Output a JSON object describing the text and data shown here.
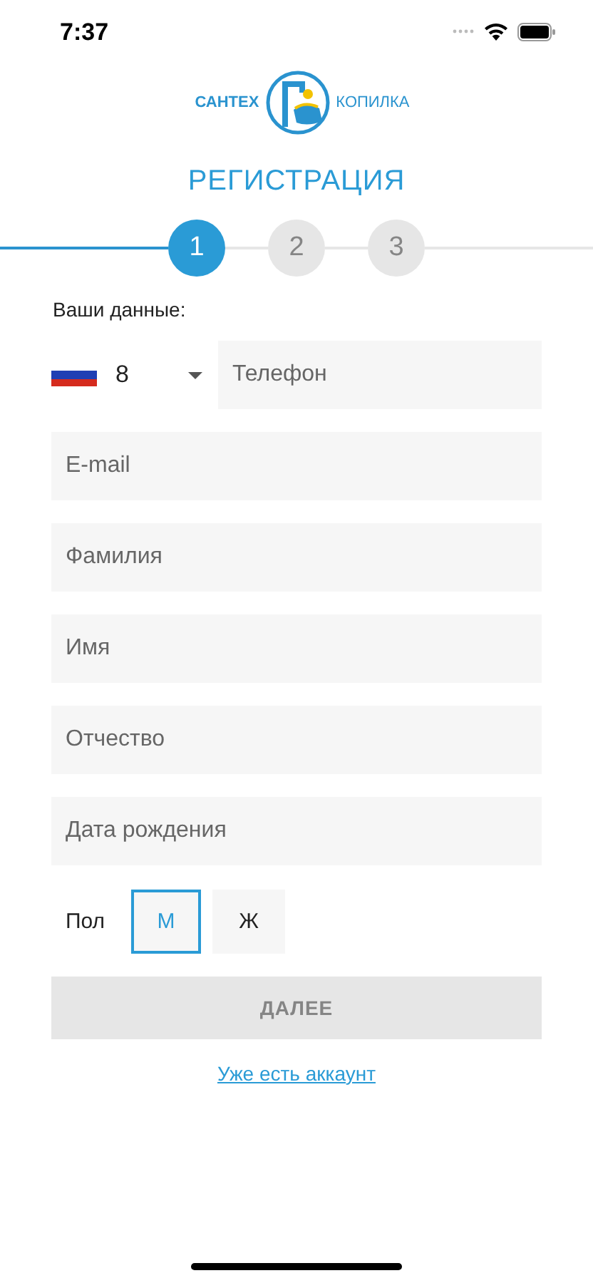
{
  "status_bar": {
    "time": "7:37"
  },
  "logo": {
    "left": "САНТЕХ",
    "right": "КОПИЛКА"
  },
  "title": "РЕГИСТРАЦИЯ",
  "steps": [
    {
      "label": "1",
      "selected": true
    },
    {
      "label": "2",
      "selected": false
    },
    {
      "label": "3",
      "selected": false
    }
  ],
  "section_label": "Ваши данные:",
  "phone": {
    "country_code": "8",
    "placeholder": "Телефон"
  },
  "fields": [
    {
      "placeholder": "E-mail"
    },
    {
      "placeholder": "Фамилия"
    },
    {
      "placeholder": "Имя"
    },
    {
      "placeholder": "Отчество"
    },
    {
      "placeholder": "Дата рождения"
    }
  ],
  "gender": {
    "label": "Пол",
    "options": [
      {
        "label": "М",
        "selected": true
      },
      {
        "label": "Ж",
        "selected": false
      }
    ]
  },
  "next_button": {
    "label": "ДАЛЕЕ",
    "disabled": true
  },
  "login_link": "Уже есть аккаунт"
}
